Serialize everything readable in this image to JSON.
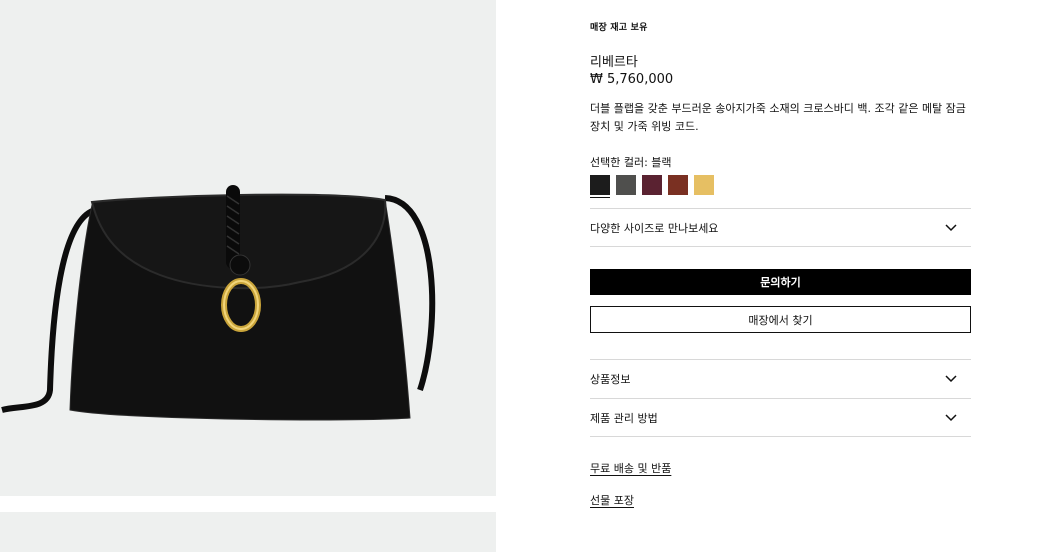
{
  "product": {
    "stock_badge": "매장 재고 보유",
    "name": "리베르타",
    "price": "₩ 5,760,000",
    "description": "더블 플랩을 갖춘 부드러운 송아지가죽 소재의 크로스바디 백. 조각 같은 메탈 잠금장치 및 가죽 위빙 코드.",
    "image_icon": "handbag-photo"
  },
  "colors": {
    "label": "선택한 컬러: 블랙",
    "swatches": [
      {
        "color": "#1c1c1c",
        "selected": true
      },
      {
        "color": "#4f4f4d",
        "selected": false
      },
      {
        "color": "#5a2231",
        "selected": false
      },
      {
        "color": "#7a3022",
        "selected": false
      },
      {
        "color": "#e6bf63",
        "selected": false
      }
    ]
  },
  "sizes": {
    "label": "다양한 사이즈로 만나보세요",
    "icon": "chevron-down-icon"
  },
  "actions": {
    "inquire": "문의하기",
    "find_store": "매장에서 찾기"
  },
  "accordions": [
    {
      "label": "상품정보",
      "icon": "chevron-down-icon"
    },
    {
      "label": "제품 관리 방법",
      "icon": "chevron-down-icon"
    }
  ],
  "links": {
    "shipping": "무료 배송 및 반품",
    "gift": "선물 포장"
  }
}
